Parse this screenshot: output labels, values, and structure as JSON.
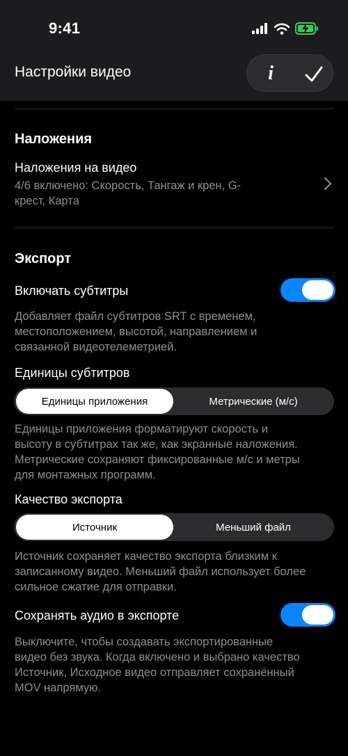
{
  "status_bar": {
    "time": "9:41"
  },
  "nav": {
    "title": "Настройки видео",
    "info_label": "i"
  },
  "overlays": {
    "section_title": "Наложения",
    "row_title": "Наложения на видео",
    "row_value_line1": "4/6 включено: Скорость, Тангаж и крен, G-",
    "row_value_line2": "крест, Карта"
  },
  "export": {
    "section_title": "Экспорт",
    "subtitles_label": "Включать субтитры",
    "subtitles_enabled": true,
    "subtitles_desc_line1": "Добавляет файл субтитров SRT с временем,",
    "subtitles_desc_line2": "местоположением, высотой, направлением и",
    "subtitles_desc_line3": "связанной видеотелеметрией.",
    "units_label": "Единицы субтитров",
    "units_options": [
      "Единицы приложения",
      "Метрические (м/с)"
    ],
    "units_selected": "Единицы приложения",
    "units_desc_line1": "Единицы приложения форматируют скорость и",
    "units_desc_line2": "высоту в субтитрах так же, как экранные наложения.",
    "units_desc_line3": "Метрические сохраняют фиксированные м/с и метры",
    "units_desc_line4": "для монтажных программ.",
    "quality_label": "Качество экспорта",
    "quality_options": [
      "Источник",
      "Меньший файл"
    ],
    "quality_selected": "Источник",
    "quality_desc_line1": "Источник сохраняет качество экспорта близким к",
    "quality_desc_line2": "записанному видео. Меньший файл использует более",
    "quality_desc_line3": "сильное сжатие для отправки.",
    "audio_label": "Сохранять аудио в экспорте",
    "audio_enabled": true,
    "audio_desc_line1": "Выключите, чтобы создавать экспортированные",
    "audio_desc_line2": "видео без звука. Когда включено и выбрано качество",
    "audio_desc_line3": "Источник, Исходное видео отправляет сохранённый",
    "audio_desc_line4": "MOV напрямую."
  },
  "colors": {
    "accent": "#0a84ff",
    "battery": "#30d158",
    "background": "#000000",
    "header": "#1c1c1e",
    "secondary_text": "#8e8e93"
  }
}
